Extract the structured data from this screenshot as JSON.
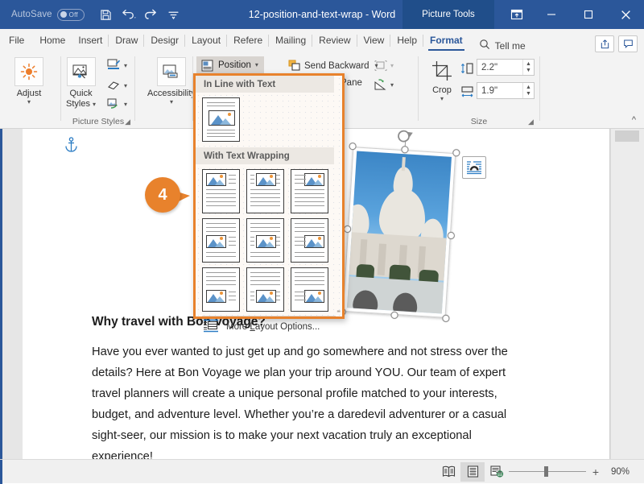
{
  "titlebar": {
    "autosave_label": "AutoSave",
    "autosave_state": "Off",
    "document_title": "12-position-and-text-wrap - Word",
    "contextual_tab": "Picture Tools",
    "quick_access": [
      {
        "name": "save-icon",
        "tooltip": "Save"
      },
      {
        "name": "undo-icon",
        "tooltip": "Undo"
      },
      {
        "name": "redo-icon",
        "tooltip": "Redo"
      },
      {
        "name": "customize-quick-access-icon",
        "tooltip": "Customize Quick Access Toolbar"
      }
    ],
    "window_buttons": [
      {
        "name": "ribbon-display-options-icon",
        "label": "Ribbon Display Options"
      },
      {
        "name": "minimize-icon",
        "label": "Minimize"
      },
      {
        "name": "maximize-icon",
        "label": "Maximize"
      },
      {
        "name": "close-icon",
        "label": "Close"
      }
    ]
  },
  "tabs": [
    {
      "label": "File",
      "active": false
    },
    {
      "label": "Home",
      "active": false
    },
    {
      "label": "Insert",
      "active": false
    },
    {
      "label": "Draw",
      "active": false
    },
    {
      "label": "Desigr",
      "active": false
    },
    {
      "label": "Layout",
      "active": false
    },
    {
      "label": "Refere",
      "active": false
    },
    {
      "label": "Mailing",
      "active": false
    },
    {
      "label": "Review",
      "active": false
    },
    {
      "label": "View",
      "active": false
    },
    {
      "label": "Help",
      "active": false
    },
    {
      "label": "Format",
      "active": true
    }
  ],
  "tellme": {
    "label": "Tell me",
    "icon": "search-icon"
  },
  "tab_right_buttons": [
    {
      "name": "share-icon",
      "label": "Share"
    },
    {
      "name": "comments-icon",
      "label": "Comments"
    }
  ],
  "ribbon": {
    "groups": [
      {
        "name": "adjust",
        "label": "Adjust",
        "button": {
          "label": "Adjust",
          "icon": "brightness-icon"
        }
      },
      {
        "name": "picture-styles",
        "label": "Picture Styles",
        "button": {
          "label": "Quick\nStyles",
          "icon": "quick-styles-icon"
        },
        "small_items": [
          {
            "label": "",
            "icon": "picture-border-icon"
          },
          {
            "label": "",
            "icon": "picture-effects-icon"
          },
          {
            "label": "",
            "icon": "picture-layout-icon"
          }
        ]
      },
      {
        "name": "accessibility",
        "label": "",
        "button": {
          "label": "Accessibility",
          "icon": "alt-text-icon"
        }
      },
      {
        "name": "arrange",
        "label": "",
        "items": [
          {
            "label": "Position",
            "icon": "position-icon"
          },
          {
            "label": "Send Backward",
            "icon": "send-backward-icon"
          },
          {
            "label": "Pane",
            "icon": "selection-pane-icon"
          },
          {
            "label": "",
            "icon": "align-objects-icon"
          },
          {
            "label": "",
            "icon": "rotate-objects-icon"
          }
        ]
      },
      {
        "name": "size",
        "label": "Size",
        "crop_label": "Crop",
        "height_value": "2.2\"",
        "width_value": "1.9\"",
        "height_icon": "shape-height-icon",
        "width_icon": "shape-width-icon"
      }
    ],
    "collapse_icon": "collapse-ribbon-icon"
  },
  "position_dropdown": {
    "category_inline": "In Line with Text",
    "category_wrapping": "With Text Wrapping",
    "inline_options": [
      {
        "name": "in-line-with-text",
        "layout": "inline"
      }
    ],
    "wrapping_options": [
      {
        "name": "top-left-square",
        "layout": "top-left"
      },
      {
        "name": "top-center-square",
        "layout": "top-center"
      },
      {
        "name": "top-right-square",
        "layout": "top-right"
      },
      {
        "name": "middle-left-square",
        "layout": "middle-left"
      },
      {
        "name": "middle-center-square",
        "layout": "middle-center"
      },
      {
        "name": "middle-right-square",
        "layout": "middle-right"
      },
      {
        "name": "bottom-left-square",
        "layout": "bottom-left"
      },
      {
        "name": "bottom-center-square",
        "layout": "bottom-center"
      },
      {
        "name": "bottom-right-square",
        "layout": "bottom-right"
      }
    ],
    "more_label_pre": "More ",
    "more_label_underline": "L",
    "more_label_post": "ayout Options...",
    "more_icon": "more-layout-options-icon"
  },
  "callout": {
    "number": "4",
    "color": "#e8822c"
  },
  "document": {
    "heading": "Why travel with Bon Voyage?",
    "paragraph": "Have you ever wanted to just get up and go somewhere and not stress over the details?  Here at Bon Voyage we plan your trip around YOU. Our team of expert travel planners will create a unique personal profile matched to your interests, budget, and adventure level. Whether you’re a daredevil adventurer or a casual sight-seer, our mission is to make your next vacation truly an exceptional experience!",
    "anchor_icon": "object-anchor-icon",
    "picture": {
      "name": "sacre-coeur-photo",
      "alt": "Sacré-Cœur basilica photo",
      "rotated": true
    },
    "layout_options_button": {
      "name": "layout-options-icon",
      "label": "Layout Options"
    }
  },
  "statusbar": {
    "views": [
      {
        "name": "read-mode-icon",
        "selected": false
      },
      {
        "name": "print-layout-icon",
        "selected": true
      },
      {
        "name": "web-layout-icon",
        "selected": false
      }
    ],
    "zoom_out": "−",
    "zoom_in": "+",
    "zoom_level": "90%"
  },
  "colors": {
    "titlebar": "#2b579a",
    "contextual_tab": "#204e8a",
    "accent_orange": "#e8822c",
    "ribbon_bg": "#f3f3f3"
  }
}
